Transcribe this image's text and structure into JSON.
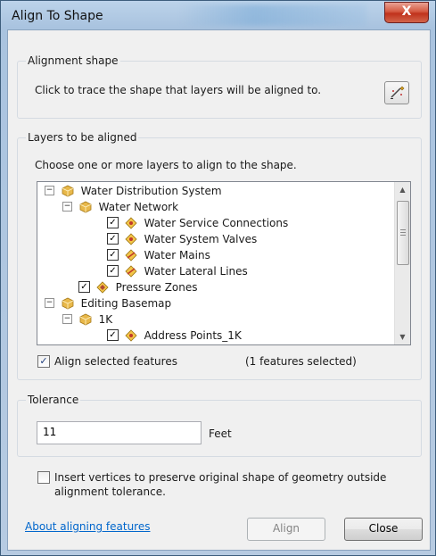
{
  "window": {
    "title": "Align To Shape",
    "close_glyph": "X"
  },
  "alignment_shape": {
    "group_label": "Alignment shape",
    "instruction": "Click to trace the shape that layers will be aligned to."
  },
  "layers": {
    "group_label": "Layers to be aligned",
    "instruction": "Choose one or more layers to align to the shape.",
    "tree": [
      {
        "label": "Water Distribution System",
        "expander": "⊟",
        "checked": null,
        "icon": "group-layer"
      },
      {
        "label": "Water Network",
        "expander": "⊟",
        "checked": null,
        "icon": "group-layer"
      },
      {
        "label": "Water Service Connections",
        "expander": null,
        "checked": true,
        "icon": "point-layer"
      },
      {
        "label": "Water System Valves",
        "expander": null,
        "checked": true,
        "icon": "point-layer"
      },
      {
        "label": "Water Mains",
        "expander": null,
        "checked": true,
        "icon": "line-layer"
      },
      {
        "label": "Water Lateral Lines",
        "expander": null,
        "checked": true,
        "icon": "line-layer"
      },
      {
        "label": "Pressure Zones",
        "expander": null,
        "checked": true,
        "icon": "polygon-layer"
      },
      {
        "label": "Editing Basemap",
        "expander": "⊟",
        "checked": null,
        "icon": "group-layer"
      },
      {
        "label": "1K",
        "expander": "⊟",
        "checked": null,
        "icon": "group-layer"
      },
      {
        "label": "Address Points_1K",
        "expander": null,
        "checked": true,
        "icon": "point-layer"
      }
    ],
    "align_selected_label": "Align selected features",
    "align_selected_checked": true,
    "selected_count_text": "(1 features selected)"
  },
  "tolerance": {
    "group_label": "Tolerance",
    "value": "11",
    "units": "Feet"
  },
  "insert_vertices": {
    "checked": false,
    "label_line1": "Insert vertices to preserve original shape of geometry outside",
    "label_line2": "alignment tolerance."
  },
  "footer": {
    "help_link": "About aligning features",
    "align_label": "Align",
    "close_label": "Close"
  },
  "colors": {
    "accent_link": "#0066cc",
    "group_icon": "#e8b84a",
    "close_red": "#c0321c"
  }
}
